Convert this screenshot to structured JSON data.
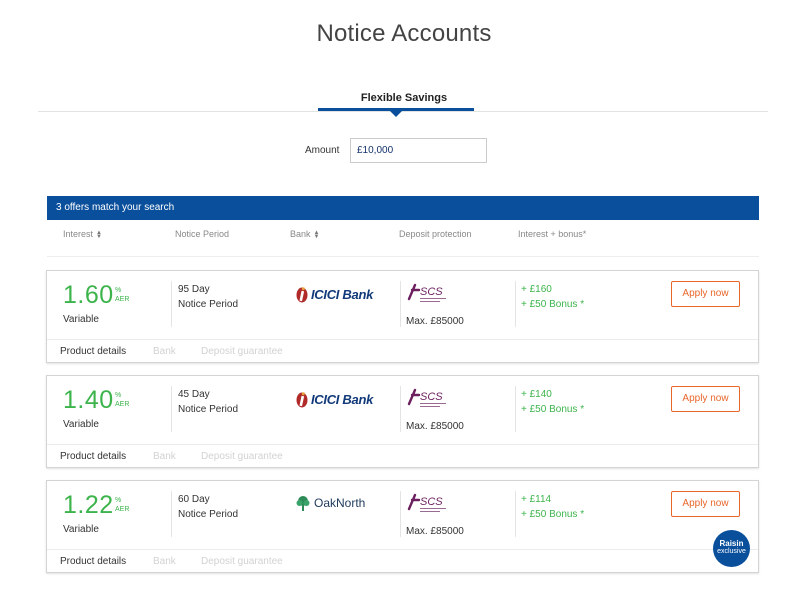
{
  "page": {
    "title": "Notice Accounts"
  },
  "tabs": [
    {
      "label": "Flexible Savings",
      "active": true
    }
  ],
  "search": {
    "amount_label": "Amount",
    "amount_value": "£10,000"
  },
  "results": {
    "summary": "3 offers match your search"
  },
  "columns": {
    "interest": "Interest",
    "notice_period": "Notice Period",
    "bank": "Bank",
    "deposit_protection": "Deposit protection",
    "interest_bonus": "Interest + bonus*"
  },
  "offers": [
    {
      "rate": "1.60",
      "rate_unit": "%",
      "rate_type_short": "AER",
      "rate_kind": "Variable",
      "notice_line1": "95 Day",
      "notice_line2": "Notice Period",
      "bank": {
        "name": "ICICI Bank",
        "logo": "icici-logo"
      },
      "protection": {
        "logo": "fscs-logo",
        "max": "Max. £85000"
      },
      "interest": "+ £160",
      "bonus": "+ £50 Bonus *",
      "apply_label": "Apply now",
      "links": {
        "product_details": "Product details",
        "bank": "Bank",
        "deposit_guarantee": "Deposit guarantee"
      }
    },
    {
      "rate": "1.40",
      "rate_unit": "%",
      "rate_type_short": "AER",
      "rate_kind": "Variable",
      "notice_line1": "45 Day",
      "notice_line2": "Notice Period",
      "bank": {
        "name": "ICICI Bank",
        "logo": "icici-logo"
      },
      "protection": {
        "logo": "fscs-logo",
        "max": "Max. £85000"
      },
      "interest": "+ £140",
      "bonus": "+ £50 Bonus *",
      "apply_label": "Apply now",
      "links": {
        "product_details": "Product details",
        "bank": "Bank",
        "deposit_guarantee": "Deposit guarantee"
      }
    },
    {
      "rate": "1.22",
      "rate_unit": "%",
      "rate_type_short": "AER",
      "rate_kind": "Variable",
      "notice_line1": "60 Day",
      "notice_line2": "Notice Period",
      "bank": {
        "name": "OakNorth",
        "logo": "oaknorth-logo"
      },
      "protection": {
        "logo": "fscs-logo",
        "max": "Max. £85000"
      },
      "interest": "+ £114",
      "bonus": "+ £50 Bonus *",
      "apply_label": "Apply now",
      "links": {
        "product_details": "Product details",
        "bank": "Bank",
        "deposit_guarantee": "Deposit guarantee"
      },
      "badge": {
        "line1": "Raisin",
        "line2": "exclusive"
      }
    }
  ],
  "colors": {
    "brand_blue": "#0a4f9c",
    "rate_green": "#3cb44b",
    "apply_orange": "#e8662a",
    "fscs_purple": "#6b1f5e"
  }
}
